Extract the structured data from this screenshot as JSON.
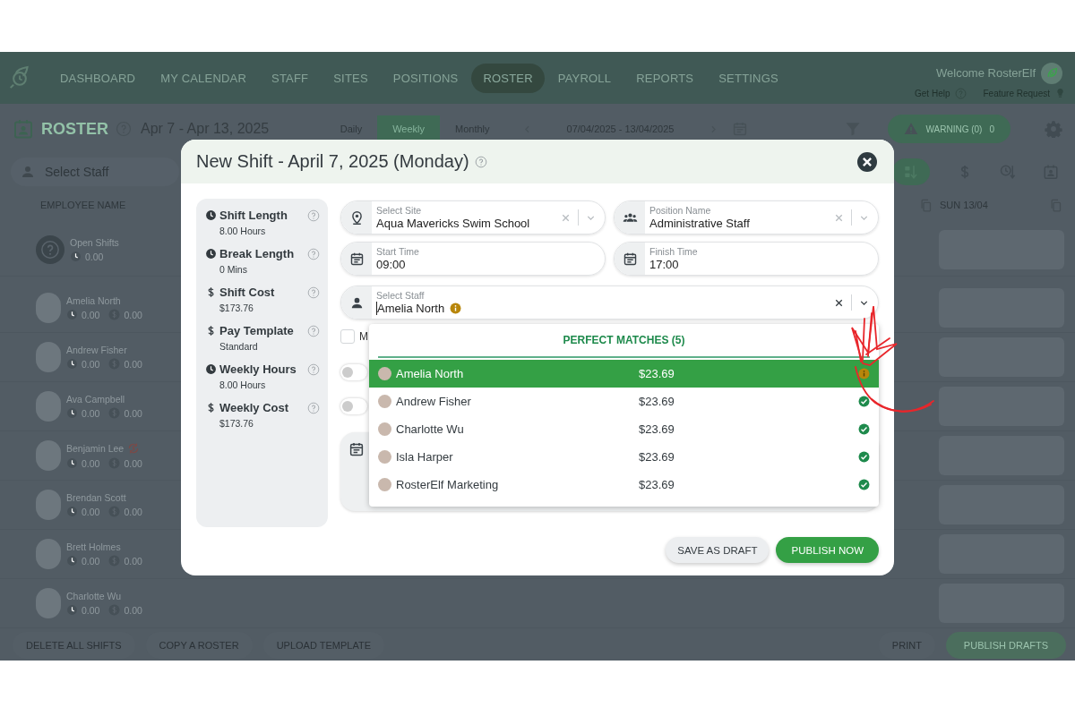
{
  "nav": {
    "items": [
      {
        "label": "DASHBOARD",
        "selected": false
      },
      {
        "label": "MY CALENDAR",
        "selected": false
      },
      {
        "label": "STAFF",
        "selected": false
      },
      {
        "label": "SITES",
        "selected": false
      },
      {
        "label": "POSITIONS",
        "selected": false
      },
      {
        "label": "ROSTER",
        "selected": true
      },
      {
        "label": "PAYROLL",
        "selected": false
      },
      {
        "label": "REPORTS",
        "selected": false
      },
      {
        "label": "SETTINGS",
        "selected": false
      }
    ],
    "welcome": "Welcome RosterElf",
    "links": [
      "Get Help",
      "Feature Request"
    ]
  },
  "roster_bar": {
    "title": "ROSTER",
    "date_range": "Apr 7 - Apr 13, 2025",
    "views": [
      {
        "label": "Daily",
        "selected": false
      },
      {
        "label": "Weekly",
        "selected": true
      },
      {
        "label": "Monthly",
        "selected": false
      }
    ],
    "period": "07/04/2025 - 13/04/2025",
    "warning": "WARNING (0)",
    "warning_count": "0"
  },
  "staff_filter": {
    "placeholder": "Select Staff"
  },
  "table": {
    "columns": [
      "EMPLOYEE NAME",
      "SUN 13/04"
    ],
    "rows": [
      {
        "kind": "open",
        "name": "Open Shifts",
        "hours": "0.00",
        "alert": false
      },
      {
        "kind": "staff",
        "name": "Amelia North",
        "hours": "0.00",
        "cost": "0.00",
        "alert": false
      },
      {
        "kind": "staff",
        "name": "Andrew Fisher",
        "hours": "0.00",
        "cost": "0.00",
        "alert": false
      },
      {
        "kind": "staff",
        "name": "Ava Campbell",
        "hours": "0.00",
        "cost": "0.00",
        "alert": false
      },
      {
        "kind": "staff",
        "name": "Benjamin Lee",
        "hours": "0.00",
        "cost": "0.00",
        "alert": true
      },
      {
        "kind": "staff",
        "name": "Brendan Scott",
        "hours": "0.00",
        "cost": "0.00",
        "alert": false
      },
      {
        "kind": "staff",
        "name": "Brett Holmes",
        "hours": "0.00",
        "cost": "0.00",
        "alert": false
      },
      {
        "kind": "staff",
        "name": "Charlotte Wu",
        "hours": "0.00",
        "cost": "0.00",
        "alert": false
      }
    ]
  },
  "footer": {
    "left": [
      "DELETE ALL SHIFTS",
      "COPY A ROSTER",
      "UPLOAD TEMPLATE"
    ],
    "right": [
      "PRINT",
      "PUBLISH DRAFTS"
    ]
  },
  "modal": {
    "title": "New Shift - April 7, 2025 (Monday)",
    "summary": [
      {
        "kind": "clock",
        "label": "Shift Length",
        "value": "8.00 Hours"
      },
      {
        "kind": "clock",
        "label": "Break Length",
        "value": "0 Mins"
      },
      {
        "kind": "dollar",
        "label": "Shift Cost",
        "value": "$173.76"
      },
      {
        "kind": "dollar",
        "label": "Pay Template",
        "value": "Standard"
      },
      {
        "kind": "clock",
        "label": "Weekly Hours",
        "value": "8.00 Hours"
      },
      {
        "kind": "dollar",
        "label": "Weekly Cost",
        "value": "$173.76"
      }
    ],
    "fields": [
      {
        "kind": "site",
        "label": "Select Site",
        "value": "Aqua Mavericks Swim School"
      },
      {
        "kind": "position",
        "label": "Position Name",
        "value": "Administrative Staff"
      },
      {
        "kind": "start",
        "label": "Start Time",
        "value": "09:00"
      },
      {
        "kind": "finish",
        "label": "Finish Time",
        "value": "17:00"
      }
    ],
    "staff": {
      "label": "Select Staff",
      "value": "Amelia North"
    },
    "checkbox": {
      "label": "M",
      "checked": false
    },
    "toggles": [
      {
        "on": false
      },
      {
        "on": false
      }
    ],
    "dropdown": {
      "heading": "PERFECT MATCHES (5)",
      "items": [
        {
          "name": "Amelia North",
          "rate": "$23.69",
          "kind": "warning",
          "selected": true
        },
        {
          "name": "Andrew Fisher",
          "rate": "$23.69",
          "kind": "ok",
          "selected": false
        },
        {
          "name": "Charlotte Wu",
          "rate": "$23.69",
          "kind": "ok",
          "selected": false
        },
        {
          "name": "Isla Harper",
          "rate": "$23.69",
          "kind": "ok",
          "selected": false
        },
        {
          "name": "RosterElf Marketing",
          "rate": "$23.69",
          "kind": "ok",
          "selected": false
        }
      ]
    },
    "buttons": [
      "SAVE AS DRAFT",
      "PUBLISH NOW"
    ]
  }
}
